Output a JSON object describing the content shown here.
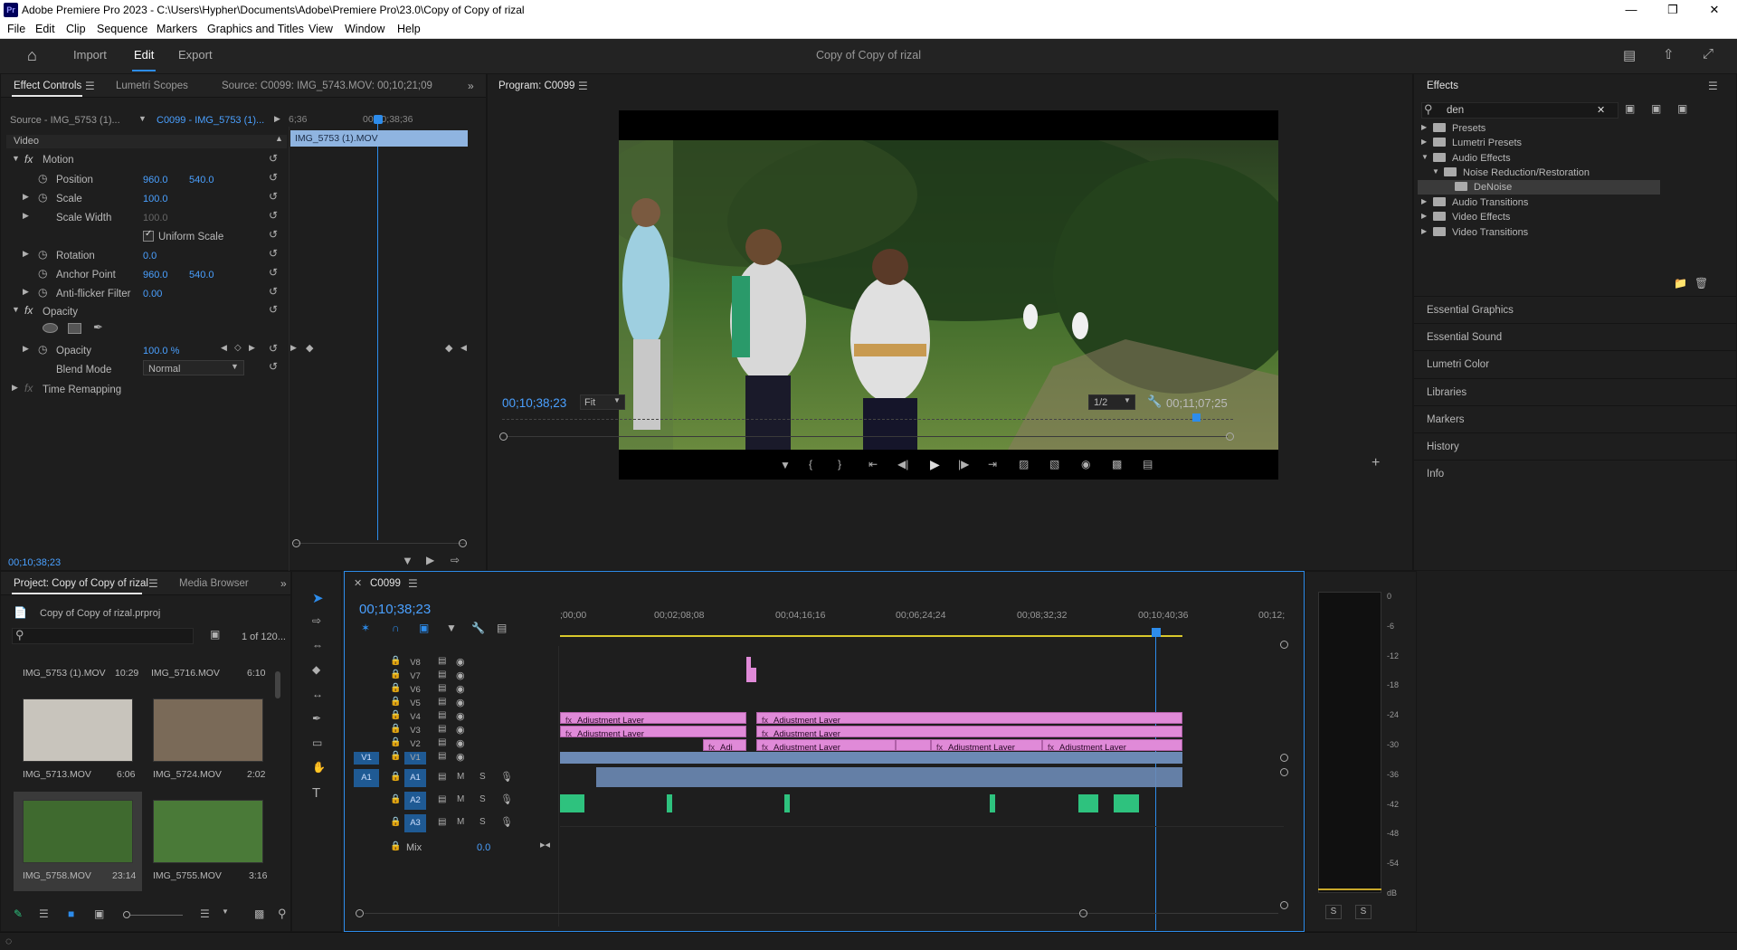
{
  "window": {
    "title": "Adobe Premiere Pro 2023 - C:\\Users\\Hypher\\Documents\\Adobe\\Premiere Pro\\23.0\\Copy of Copy of rizal",
    "logo": "Pr"
  },
  "menu": [
    "File",
    "Edit",
    "Clip",
    "Sequence",
    "Markers",
    "Graphics and Titles",
    "View",
    "Window",
    "Help"
  ],
  "header": {
    "tabs": [
      "Import",
      "Edit",
      "Export"
    ],
    "project_title": "Copy of Copy of rizal"
  },
  "effect_controls": {
    "tabs": [
      "Effect Controls",
      "Lumetri Scopes"
    ],
    "source_label": "Source: C0099: IMG_5743.MOV: 00;10;21;09",
    "source_select": "Source - IMG_5753 (1)...",
    "sequence_select": "C0099 - IMG_5753 (1)...",
    "time_start": "6;36",
    "time_marker": "00;10;38;36",
    "clip_name": "IMG_5753 (1).MOV",
    "section_video": "Video",
    "motion": "Motion",
    "position_label": "Position",
    "position_x": "960.0",
    "position_y": "540.0",
    "scale_label": "Scale",
    "scale_val": "100.0",
    "scale_width_label": "Scale Width",
    "scale_width_val": "100.0",
    "uniform_scale": "Uniform Scale",
    "rotation_label": "Rotation",
    "rotation_val": "0.0",
    "anchor_label": "Anchor Point",
    "anchor_x": "960.0",
    "anchor_y": "540.0",
    "antiflicker_label": "Anti-flicker Filter",
    "antiflicker_val": "0.00",
    "opacity_section": "Opacity",
    "opacity_label": "Opacity",
    "opacity_val": "100.0 %",
    "blend_label": "Blend Mode",
    "blend_val": "Normal",
    "time_remap": "Time Remapping",
    "current_time": "00;10;38;23"
  },
  "program": {
    "title": "Program: C0099",
    "timecode": "00;10;38;23",
    "fit": "Fit",
    "resolution": "1/2",
    "duration": "00;11;07;25"
  },
  "effects": {
    "title": "Effects",
    "search_value": "den",
    "tree": [
      {
        "label": "Presets",
        "level": 0
      },
      {
        "label": "Lumetri Presets",
        "level": 0
      },
      {
        "label": "Audio Effects",
        "level": 0
      },
      {
        "label": "Noise Reduction/Restoration",
        "level": 1
      },
      {
        "label": "DeNoise",
        "level": 2
      },
      {
        "label": "Audio Transitions",
        "level": 0
      },
      {
        "label": "Video Effects",
        "level": 0
      },
      {
        "label": "Video Transitions",
        "level": 0
      }
    ],
    "panels": [
      "Essential Graphics",
      "Essential Sound",
      "Lumetri Color",
      "Libraries",
      "Markers",
      "History",
      "Info"
    ]
  },
  "project": {
    "tabs": [
      "Project: Copy of Copy of rizal",
      "Media Browser"
    ],
    "file": "Copy of Copy of rizal.prproj",
    "count": "1 of 120...",
    "items": [
      {
        "name": "IMG_5753 (1).MOV",
        "dur": "10:29"
      },
      {
        "name": "IMG_5716.MOV",
        "dur": "6:10"
      },
      {
        "name": "IMG_5713.MOV",
        "dur": "6:06"
      },
      {
        "name": "IMG_5724.MOV",
        "dur": "2:02"
      },
      {
        "name": "IMG_5758.MOV",
        "dur": "23:14"
      },
      {
        "name": "IMG_5755.MOV",
        "dur": "3:16"
      }
    ]
  },
  "timeline": {
    "sequence": "C0099",
    "timecode": "00;10;38;23",
    "ruler": [
      ";00;00",
      "00;02;08;08",
      "00;04;16;16",
      "00;06;24;24",
      "00;08;32;32",
      "00;10;40;36",
      "00;12;"
    ],
    "video_tracks": [
      "V8",
      "V7",
      "V6",
      "V5",
      "V4",
      "V3",
      "V2",
      "V1"
    ],
    "audio_tracks": [
      "A1",
      "A2",
      "A3"
    ],
    "src_v": "V1",
    "src_a": "A1",
    "mix_label": "Mix",
    "mix_val": "0.0",
    "adj_layer": "Adjustment Layer",
    "adj_short": "Adj",
    "m": "M",
    "s": "S"
  },
  "meter": {
    "scale": [
      "0",
      "-6",
      "-12",
      "-18",
      "-24",
      "-30",
      "-36",
      "-42",
      "-48",
      "-54",
      "dB"
    ],
    "solo": [
      "S",
      "S"
    ]
  },
  "colors": {
    "accent": "#2d8ceb",
    "adjustment": "#e08ad8",
    "audio_green": "#2ec27e",
    "clip_blue": "#8fb4e0"
  }
}
